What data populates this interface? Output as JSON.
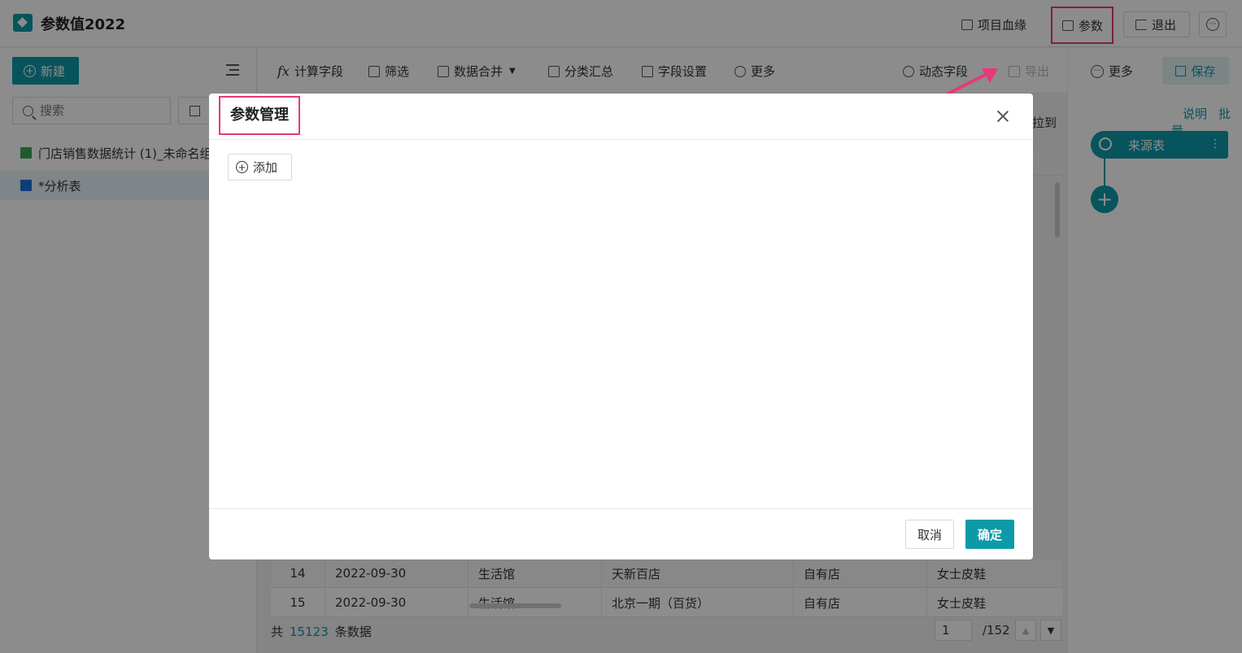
{
  "header": {
    "title": "参数值2022",
    "lineage_label": "项目血缘",
    "param_label": "参数",
    "exit_label": "退出",
    "more_symbol": "···"
  },
  "left_panel": {
    "new_label": "新建",
    "search_placeholder": "搜索",
    "tree": [
      {
        "label": "门店销售数据统计 (1)_未命名组"
      },
      {
        "label": "*分析表"
      }
    ]
  },
  "toolbar": {
    "calc_symbol": "fx",
    "calc_label": "计算字段",
    "filter_label": "筛选",
    "merge_label": "数据合并",
    "group_label": "分类汇总",
    "field_label": "字段设置",
    "more_label": "更多",
    "dynamic_label": "动态字段",
    "export_label": "导出"
  },
  "right_panel": {
    "more_label": "更多",
    "save_label": "保存",
    "explain_label": "说明",
    "batch_label": "批量",
    "node_label": "来源表",
    "add_symbol": "+"
  },
  "table": {
    "peek_text": "拉到",
    "rows": [
      {
        "no": "14",
        "date": "2022-09-30",
        "category": "生活馆",
        "store": "天新百店",
        "type": "自有店",
        "product": "女士皮鞋"
      },
      {
        "no": "15",
        "date": "2022-09-30",
        "category": "生活馆",
        "store": "北京一期（百货）",
        "type": "自有店",
        "product": "女士皮鞋"
      }
    ]
  },
  "pager": {
    "prefix": "共",
    "count": "15123",
    "suffix": "条数据",
    "page": "1",
    "total": "/152"
  },
  "dialog": {
    "title": "参数管理",
    "add_label": "添加",
    "cancel_label": "取消",
    "ok_label": "确定"
  },
  "colors": {
    "brand": "#0d9aa8",
    "highlight": "#e6397a"
  }
}
